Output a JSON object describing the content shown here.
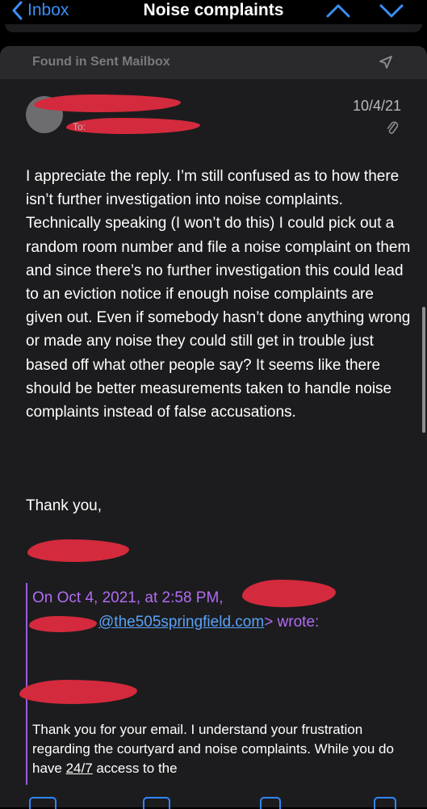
{
  "nav": {
    "back_label": "Inbox",
    "title": "Noise complaints",
    "icons": [
      "chevron-left-icon",
      "chevron-up-icon",
      "chevron-down-icon"
    ]
  },
  "banner": {
    "text": "Found in Sent Mailbox",
    "icon": "send-icon"
  },
  "header": {
    "to_prefix": "To:",
    "date": "10/4/21",
    "attachment_icon": "paperclip-icon"
  },
  "message": {
    "paragraph": "I appreciate the reply. I’m still confused as to how there isn’t further investigation into noise complaints. Technically speaking (I won’t do this) I could pick out a random room number and file a noise complaint on them and since there’s no further investigation this could lead to an eviction notice if enough noise complaints are given out. Even if somebody hasn’t done anything wrong or made any noise they could still get in trouble just based off what other people say? It seems like there should be better measurements taken to handle noise complaints instead of false accusations.",
    "closing": "Thank you,"
  },
  "quote": {
    "header_line1": "On Oct 4, 2021, at 2:58 PM,",
    "email_domain": "@the505springfield.com",
    "wrote": "> wrote:",
    "body_part1": "Thank you for your email. I understand your frustration regarding the courtyard and noise complaints. While you do have ",
    "body_underlined": "24/7",
    "body_part2": " access to the"
  },
  "colors": {
    "accent": "#3b8ff6",
    "quote": "#b16cf2",
    "redaction": "#d42a3d",
    "card_bg": "#1c1c1e"
  }
}
